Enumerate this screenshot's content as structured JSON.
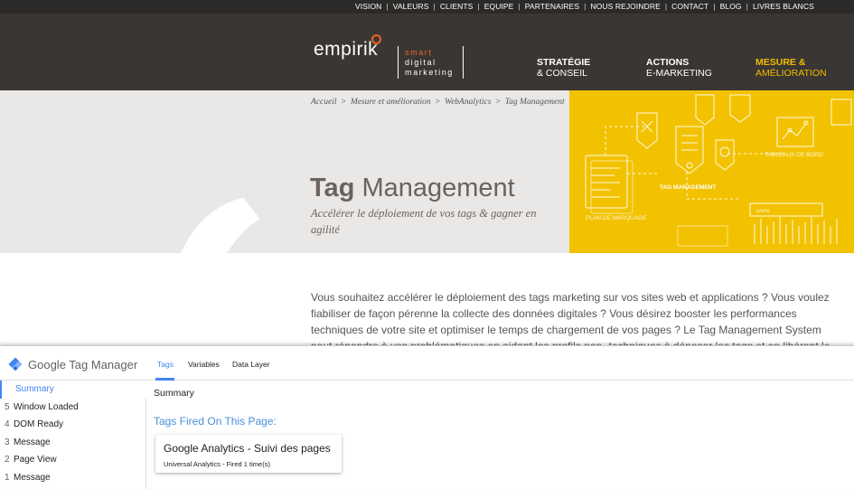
{
  "site": {
    "top_links": [
      "VISION",
      "VALEURS",
      "CLIENTS",
      "EQUIPE",
      "PARTENAIRES",
      "NOUS REJOINDRE",
      "CONTACT",
      "BLOG",
      "LIVRES BLANCS"
    ],
    "logo_text": "empirik",
    "tagline": [
      "smart",
      "digital",
      "marketing"
    ],
    "nav": [
      {
        "line1": "STRATÉGIE",
        "line2": "& CONSEIL"
      },
      {
        "line1": "ACTIONS",
        "line2": "E-MARKETING"
      },
      {
        "line1": "MESURE &",
        "line2": "AMÉLIORATION"
      }
    ],
    "breadcrumb": [
      "Accueil",
      "Mesure et amélioration",
      "WebAnalytics",
      "Tag Management"
    ],
    "breadcrumb_sep": ">",
    "hero_title_bold": "Tag",
    "hero_title_rest": " Management",
    "hero_subtitle": "Accélérer le déploiement de vos tags & gagner en agilité",
    "illustration_labels": {
      "tag": "TAG MANAGEMENT",
      "tableaux": "TABLEAUX DE BORD",
      "plan": "PLAN DE MARQUAGE",
      "www": "www."
    },
    "intro": "Vous souhaitez accélérer le déploiement des tags marketing  sur vos sites web et applications ? Vous voulez fiabiliser de façon pérenne la collecte des données digitales ? Vous désirez booster les performances techniques de votre site et optimiser le temps de chargement de vos pages ? Le Tag Management System peut répondre à vos problématiques en aidant les profils non -techniques à déposer les tags et en libérant le"
  },
  "gtm": {
    "brand": "Google Tag Manager",
    "tabs": [
      "Tags",
      "Variables",
      "Data Layer"
    ],
    "active_tab": "Tags",
    "sidebar": [
      {
        "num": "",
        "label": "Summary"
      },
      {
        "num": "5",
        "label": "Window Loaded"
      },
      {
        "num": "4",
        "label": "DOM Ready"
      },
      {
        "num": "3",
        "label": "Message"
      },
      {
        "num": "2",
        "label": "Page View"
      },
      {
        "num": "1",
        "label": "Message"
      }
    ],
    "main_title": "Summary",
    "fired_title": "Tags Fired On This Page:",
    "tag_card": {
      "title": "Google Analytics - Suivi des pages",
      "subtitle": "Universal Analytics - Fired 1 time(s)"
    },
    "colors": {
      "accent": "#4285f4",
      "brand_yellow": "#f2c200",
      "brand_orange": "#e8642a"
    }
  }
}
